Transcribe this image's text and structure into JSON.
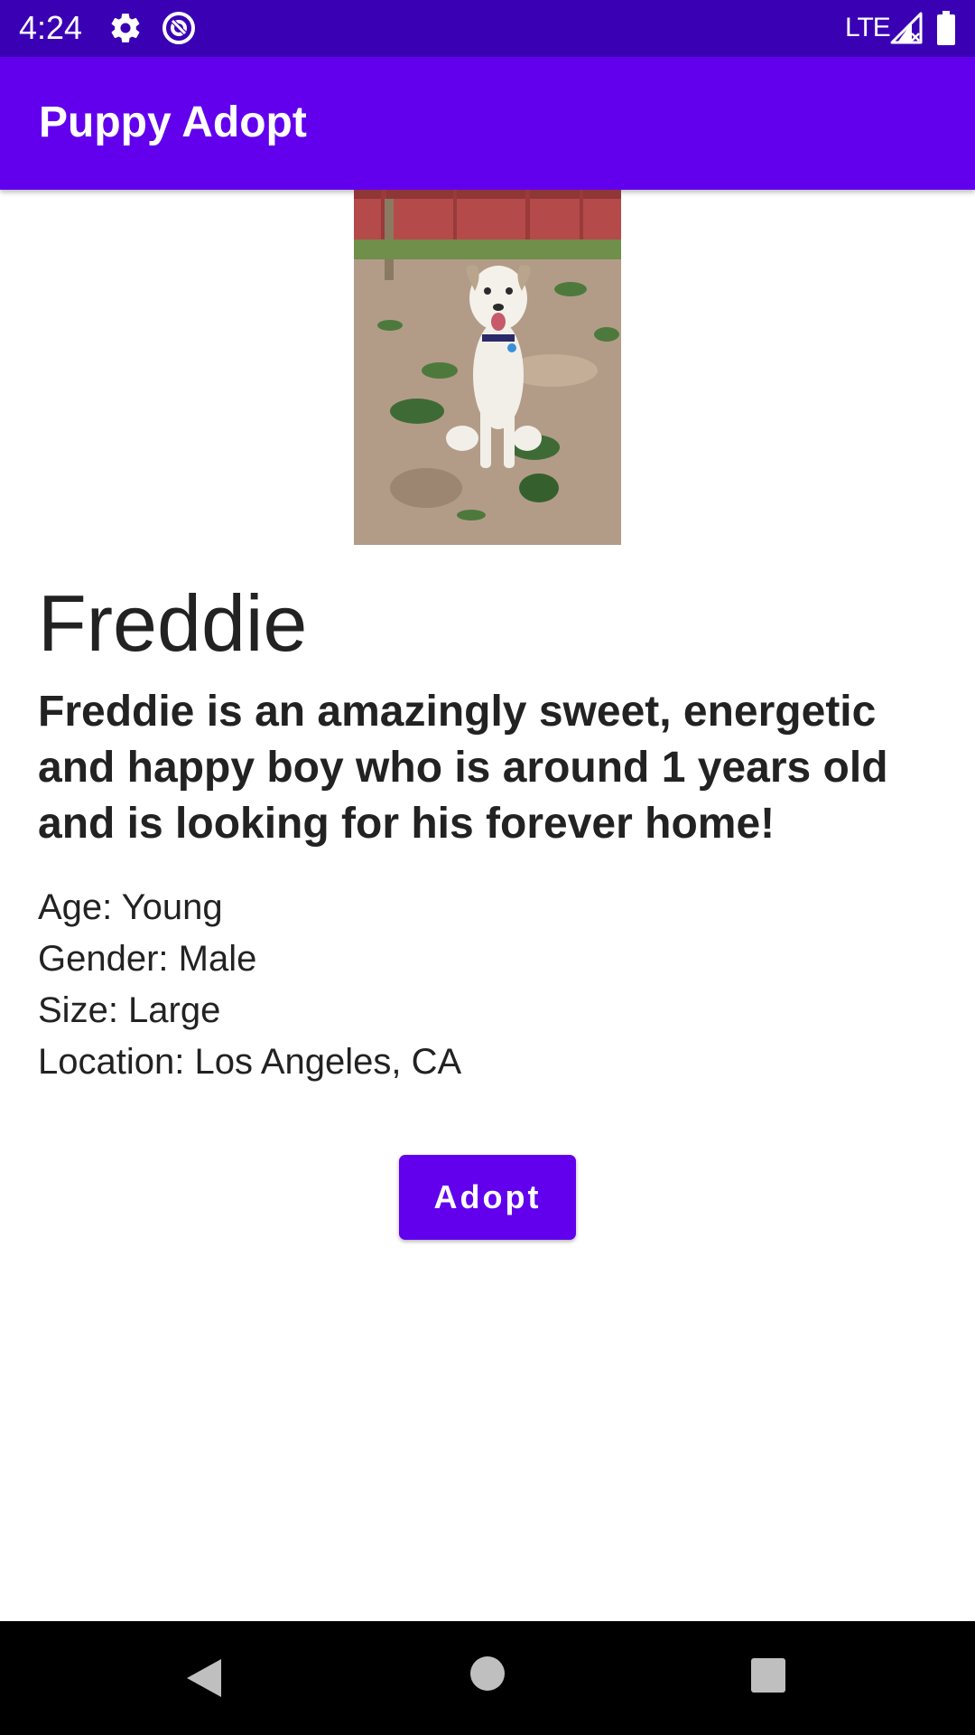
{
  "status_bar": {
    "time": "4:24",
    "network": "LTE",
    "icons": [
      "gear-icon",
      "sync-icon",
      "signal-icon",
      "battery-icon"
    ]
  },
  "app_bar": {
    "title": "Puppy Adopt"
  },
  "pet": {
    "photo_icon": "dog-photo",
    "name": "Freddie",
    "description": "Freddie is an amazingly sweet, energetic and happy boy who is around 1 years old and is looking for his forever home!",
    "details": [
      "Age: Young",
      "Gender: Male",
      "Size: Large",
      "Location: Los Angeles, CA"
    ],
    "adopt_label": "Adopt"
  },
  "nav_bar": {
    "icons": [
      "back-icon",
      "home-icon",
      "recents-icon"
    ]
  },
  "colors": {
    "status_bar": "#3a00b4",
    "primary": "#6200ee",
    "text": "#222222"
  }
}
